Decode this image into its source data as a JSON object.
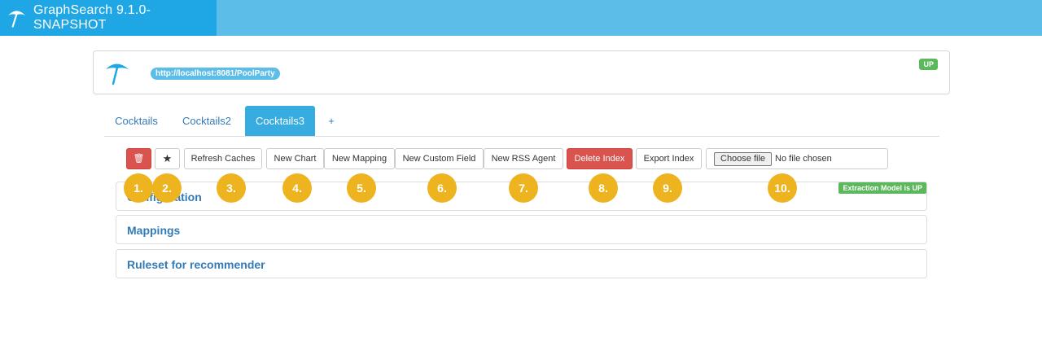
{
  "app": {
    "title": "GraphSearch 9.1.0-SNAPSHOT"
  },
  "server": {
    "url": "http://localhost:8081/PoolParty",
    "status": "UP"
  },
  "tabs": [
    {
      "label": "Cocktails"
    },
    {
      "label": "Cocktails2"
    },
    {
      "label": "Cocktails3"
    },
    {
      "label": "+"
    }
  ],
  "toolbar": {
    "delete_icon": "🗑",
    "star_icon": "★",
    "refresh_caches": "Refresh Caches",
    "new_chart": "New Chart",
    "new_mapping": "New Mapping",
    "new_custom_field": "New Custom Field",
    "new_rss_agent": "New RSS Agent",
    "delete_index": "Delete Index",
    "export_index": "Export Index",
    "file_button": "Choose file",
    "file_status": "No file chosen"
  },
  "panels": [
    {
      "title": "Configuration",
      "badge": "Extraction Model is UP"
    },
    {
      "title": "Mappings"
    },
    {
      "title": "Ruleset for recommender"
    }
  ],
  "markers": [
    "1.",
    "2.",
    "3.",
    "4.",
    "5.",
    "6.",
    "7.",
    "8.",
    "9.",
    "10."
  ],
  "colors": {
    "brand": "#1fa6e4",
    "topbar": "#5bbde8",
    "danger": "#d9534f",
    "success": "#5cb85c",
    "marker": "#eeb420",
    "link": "#337ab7"
  }
}
